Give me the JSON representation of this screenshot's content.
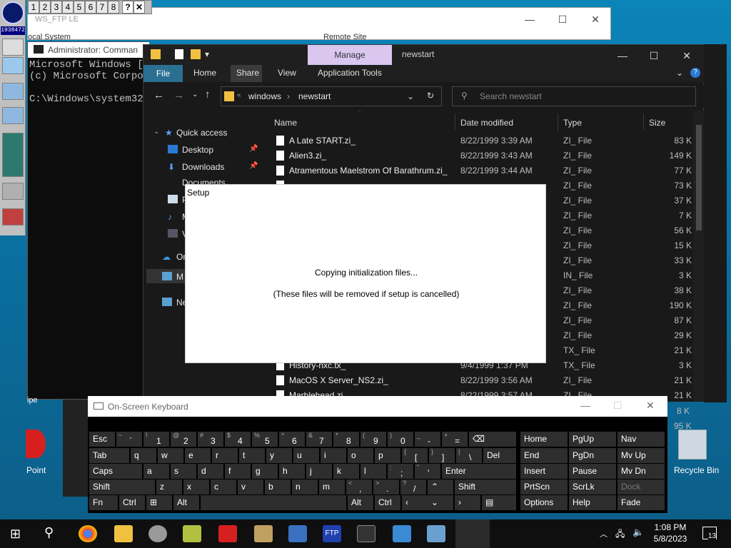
{
  "desktop": {
    "launcher_mem": "1938472",
    "numbar": [
      "1",
      "2",
      "3",
      "4",
      "5",
      "6",
      "7",
      "8",
      "?",
      "✕"
    ],
    "ppt_label": "Point",
    "ipe_label": "ipe",
    "recycle_label": "Recycle Bin"
  },
  "wsftp": {
    "title": "WS_FTP LE",
    "local_label": "ocal System",
    "remote_label": "Remote Site"
  },
  "cmd": {
    "title": "Administrator: Comman",
    "lines": [
      "Microsoft Windows [Ve",
      "(c) Microsoft Corpor",
      "C:\\Windows\\system32>"
    ]
  },
  "explorer": {
    "title": "newstart",
    "manage_tab": "Manage",
    "ribbon_tabs": [
      "File",
      "Home",
      "Share",
      "View",
      "Application Tools"
    ],
    "breadcrumb": [
      "windows",
      "newstart"
    ],
    "search_placeholder": "Search newstart",
    "nav": [
      {
        "label": "Quick access"
      },
      {
        "label": "Desktop"
      },
      {
        "label": "Downloads"
      },
      {
        "label": "Documents"
      },
      {
        "label": "P"
      },
      {
        "label": "M"
      },
      {
        "label": "V"
      },
      {
        "label": "On"
      },
      {
        "label": "M"
      },
      {
        "label": "Ne"
      }
    ],
    "columns": [
      "Name",
      "Date modified",
      "Type",
      "Size"
    ],
    "files": [
      {
        "name": "A Late START.zi_",
        "date": "8/22/1999 3:39 AM",
        "type": "ZI_ File",
        "size": "83 K"
      },
      {
        "name": "Alien3.zi_",
        "date": "8/22/1999 3:43 AM",
        "type": "ZI_ File",
        "size": "149 K"
      },
      {
        "name": "Atramentous Maelstrom Of Barathrum.zi_",
        "date": "8/22/1999 3:44 AM",
        "type": "ZI_ File",
        "size": "77 K"
      },
      {
        "name": "",
        "date": "",
        "type": "ZI_ File",
        "size": "73 K"
      },
      {
        "name": "",
        "date": "",
        "type": "ZI_ File",
        "size": "37 K"
      },
      {
        "name": "",
        "date": "",
        "type": "ZI_ File",
        "size": "7 K"
      },
      {
        "name": "",
        "date": "",
        "type": "ZI_ File",
        "size": "56 K"
      },
      {
        "name": "",
        "date": "",
        "type": "ZI_ File",
        "size": "15 K"
      },
      {
        "name": "",
        "date": "",
        "type": "ZI_ File",
        "size": "33 K"
      },
      {
        "name": "",
        "date": "",
        "type": "IN_ File",
        "size": "3 K"
      },
      {
        "name": "",
        "date": "",
        "type": "ZI_ File",
        "size": "38 K"
      },
      {
        "name": "",
        "date": "",
        "type": "ZI_ File",
        "size": "190 K"
      },
      {
        "name": "",
        "date": "",
        "type": "ZI_ File",
        "size": "87 K"
      },
      {
        "name": "",
        "date": "",
        "type": "ZI_ File",
        "size": "29 K"
      },
      {
        "name": "",
        "date": "",
        "type": "TX_ File",
        "size": "21 K"
      },
      {
        "name": "History-nxc.tx_",
        "date": "9/4/1999 1:37 PM",
        "type": "TX_ File",
        "size": "3 K"
      },
      {
        "name": "MacOS X Server_NS2.zi_",
        "date": "8/22/1999 3:56 AM",
        "type": "ZI_ File",
        "size": "21 K"
      },
      {
        "name": "Marblehead.zi_",
        "date": "8/22/1999 3:57 AM",
        "type": "ZI_ File",
        "size": "21 K"
      }
    ],
    "extra_sizes": [
      "8 K",
      "95 K"
    ]
  },
  "setup": {
    "title": "Setup",
    "message1": "Copying initialization files...",
    "message2": "(These files will be removed if setup is cancelled)"
  },
  "osk": {
    "title": "On-Screen Keyboard",
    "keys": {
      "esc": "Esc",
      "tab": "Tab",
      "caps": "Caps",
      "shift": "Shift",
      "fn": "Fn",
      "ctrl": "Ctrl",
      "alt": "Alt",
      "del": "Del",
      "enter": "Enter",
      "shift_r": "Shift",
      "alt_r": "Alt",
      "ctrl_r": "Ctrl",
      "home": "Home",
      "pgup": "PgUp",
      "nav": "Nav",
      "end": "End",
      "pgdn": "PgDn",
      "mvup": "Mv Up",
      "insert": "Insert",
      "pause": "Pause",
      "mvdn": "Mv Dn",
      "prtscn": "PrtScn",
      "scrlk": "ScrLk",
      "dock": "Dock",
      "options": "Options",
      "help": "Help",
      "fade": "Fade"
    },
    "row1": [
      [
        "~",
        "`"
      ],
      [
        "!",
        "1"
      ],
      [
        "@",
        "2"
      ],
      [
        "#",
        "3"
      ],
      [
        "$",
        "4"
      ],
      [
        "%",
        "5"
      ],
      [
        "^",
        "6"
      ],
      [
        "&",
        "7"
      ],
      [
        "*",
        "8"
      ],
      [
        "(",
        "9"
      ],
      [
        ")",
        "0"
      ],
      [
        "_",
        "-"
      ],
      [
        "+",
        "="
      ]
    ],
    "row2": [
      "q",
      "w",
      "e",
      "r",
      "t",
      "y",
      "u",
      "i",
      "o",
      "p"
    ],
    "row2b": [
      [
        "{",
        "["
      ],
      [
        "}",
        "]"
      ],
      [
        "|",
        "\\"
      ]
    ],
    "row3": [
      "a",
      "s",
      "d",
      "f",
      "g",
      "h",
      "j",
      "k",
      "l"
    ],
    "row3b": [
      [
        ":",
        ";"
      ],
      [
        "\"",
        "'"
      ]
    ],
    "row4": [
      "z",
      "x",
      "c",
      "v",
      "b",
      "n",
      "m"
    ],
    "row4b": [
      [
        "<",
        ","
      ],
      [
        ">",
        "."
      ],
      [
        "?",
        "/"
      ]
    ]
  },
  "taskbar": {
    "time": "1:08 PM",
    "date": "5/8/2023",
    "notif_count": "13"
  }
}
